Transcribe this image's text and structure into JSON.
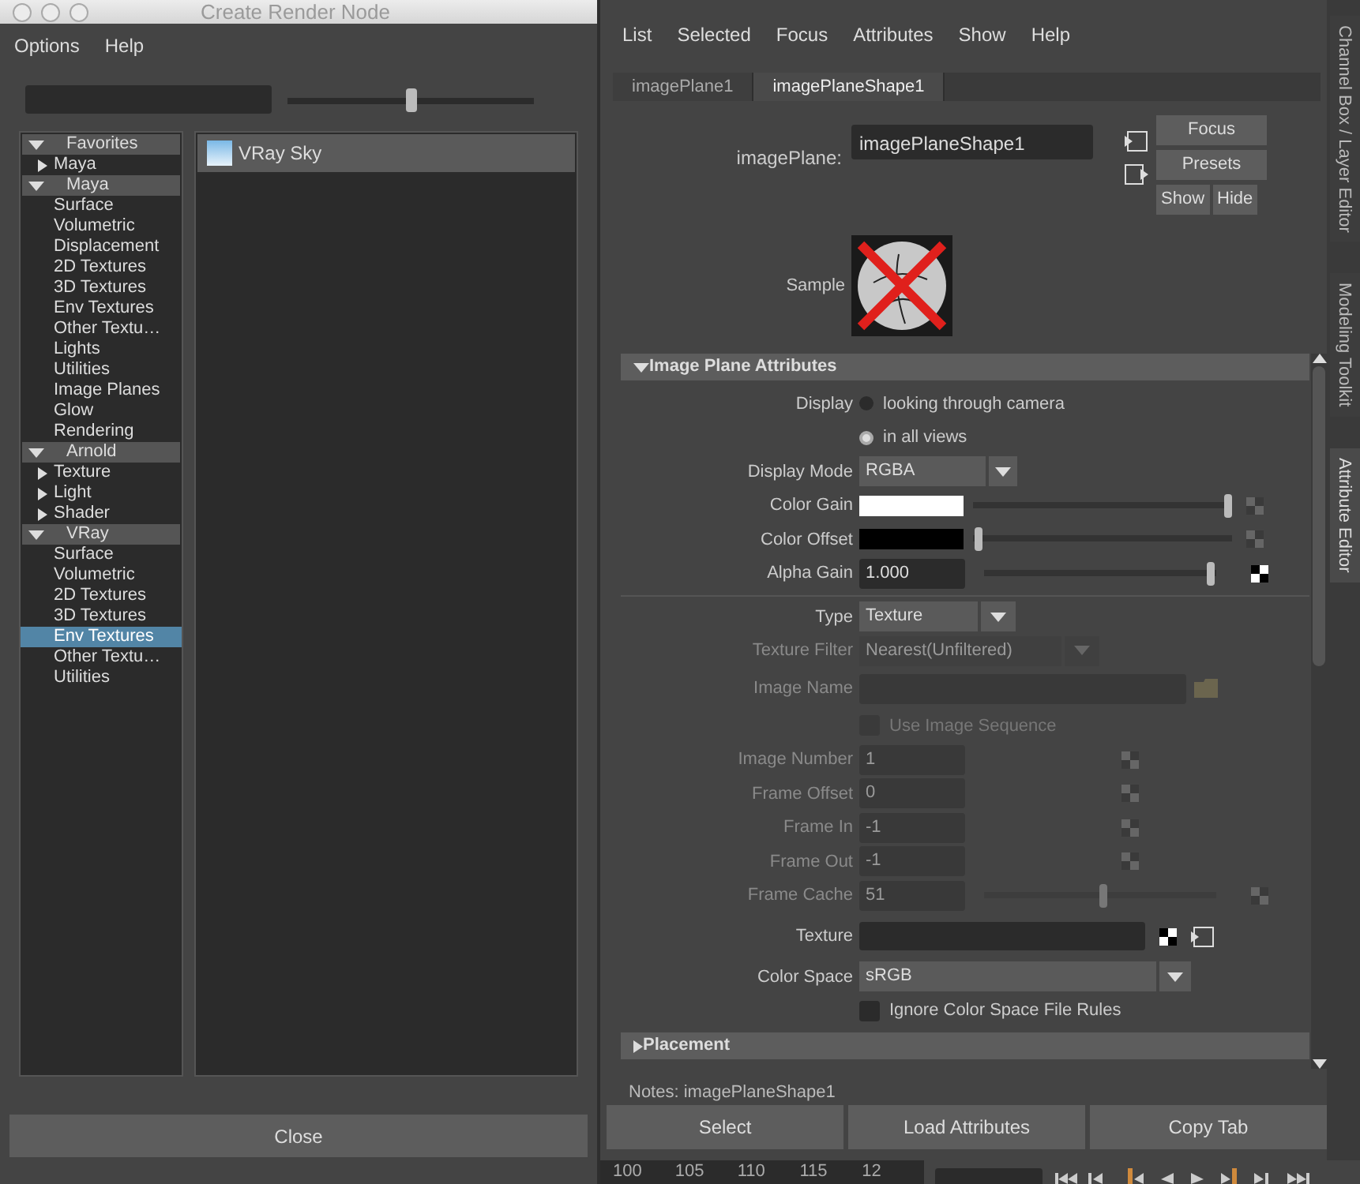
{
  "render_node_window": {
    "title": "Create Render Node",
    "menu": [
      "Options",
      "Help"
    ],
    "size_slider": {
      "level": 0.5
    },
    "tree": [
      {
        "label": "Favorites",
        "kind": "category",
        "expanded": true,
        "selected": false,
        "children": [
          {
            "label": "Maya",
            "kind": "group",
            "expanded": false,
            "selected": false
          }
        ]
      },
      {
        "label": "Maya",
        "kind": "category",
        "expanded": true,
        "selected": false,
        "children": [
          {
            "label": "Surface",
            "kind": "item",
            "selected": false
          },
          {
            "label": "Volumetric",
            "kind": "item",
            "selected": false
          },
          {
            "label": "Displacement",
            "kind": "item",
            "selected": false
          },
          {
            "label": "2D Textures",
            "kind": "item",
            "selected": false
          },
          {
            "label": "3D Textures",
            "kind": "item",
            "selected": false
          },
          {
            "label": "Env Textures",
            "kind": "item",
            "selected": false
          },
          {
            "label": "Other Textu…",
            "kind": "item",
            "selected": false
          },
          {
            "label": "Lights",
            "kind": "item",
            "selected": false
          },
          {
            "label": "Utilities",
            "kind": "item",
            "selected": false
          },
          {
            "label": "Image Planes",
            "kind": "item",
            "selected": false
          },
          {
            "label": "Glow",
            "kind": "item",
            "selected": false
          },
          {
            "label": "Rendering",
            "kind": "item",
            "selected": false
          }
        ]
      },
      {
        "label": "Arnold",
        "kind": "category",
        "expanded": true,
        "selected": false,
        "children": [
          {
            "label": "Texture",
            "kind": "group",
            "expanded": false,
            "selected": false
          },
          {
            "label": "Light",
            "kind": "group",
            "expanded": false,
            "selected": false
          },
          {
            "label": "Shader",
            "kind": "group",
            "expanded": false,
            "selected": false
          }
        ]
      },
      {
        "label": "VRay",
        "kind": "category",
        "expanded": true,
        "selected": false,
        "children": [
          {
            "label": "Surface",
            "kind": "item",
            "selected": false
          },
          {
            "label": "Volumetric",
            "kind": "item",
            "selected": false
          },
          {
            "label": "2D Textures",
            "kind": "item",
            "selected": false
          },
          {
            "label": "3D Textures",
            "kind": "item",
            "selected": false
          },
          {
            "label": "Env Textures",
            "kind": "item",
            "selected": true
          },
          {
            "label": "Other Textu…",
            "kind": "item",
            "selected": false
          },
          {
            "label": "Utilities",
            "kind": "item",
            "selected": false
          }
        ]
      }
    ],
    "nodes": [
      {
        "label": "VRay Sky",
        "selected": true
      }
    ],
    "close_button": "Close"
  },
  "attribute_editor": {
    "menu": [
      "List",
      "Selected",
      "Focus",
      "Attributes",
      "Show",
      "Help"
    ],
    "tabs": [
      {
        "label": "imagePlane1",
        "selected": false
      },
      {
        "label": "imagePlaneShape1",
        "selected": true
      }
    ],
    "node_field": {
      "label": "imagePlane:",
      "value": "imagePlaneShape1"
    },
    "buttons": [
      "Focus",
      "Presets",
      "Show",
      "Hide"
    ],
    "sample_label": "Sample",
    "sections": [
      {
        "title": "Image Plane Attributes",
        "expanded": true,
        "rows": [
          {
            "kind": "radio",
            "label": "Display",
            "options": [
              {
                "label": "looking through camera",
                "selected": false
              },
              {
                "label": "in all views",
                "selected": true
              }
            ]
          },
          {
            "kind": "dropdown",
            "label": "Display Mode",
            "value": "RGBA",
            "disabled": false
          },
          {
            "kind": "color",
            "label": "Color Gain",
            "color": "#ffffff",
            "level": 0.98
          },
          {
            "kind": "color",
            "label": "Color Offset",
            "color": "#000000",
            "level": 0.02
          },
          {
            "kind": "number",
            "label": "Alpha Gain",
            "value": "1.000",
            "level": 0.97,
            "disabled": false,
            "mappable": true
          },
          {
            "kind": "separator"
          },
          {
            "kind": "dropdown",
            "label": "Type",
            "value": "Texture",
            "disabled": false
          },
          {
            "kind": "dropdown",
            "label": "Texture Filter",
            "value": "Nearest(Unfiltered)",
            "disabled": true
          },
          {
            "kind": "file",
            "label": "Image Name",
            "disabled": true
          },
          {
            "kind": "checkbox",
            "label": "Use Image Sequence",
            "checked": false,
            "disabled": true
          },
          {
            "kind": "number",
            "label": "Image Number",
            "value": "1",
            "disabled": true,
            "mappable": true
          },
          {
            "kind": "number",
            "label": "Frame Offset",
            "value": "0",
            "disabled": true,
            "mappable": true
          },
          {
            "kind": "number",
            "label": "Frame In",
            "value": "-1",
            "disabled": true,
            "mappable": true
          },
          {
            "kind": "number",
            "label": "Frame Out",
            "value": "-1",
            "disabled": true,
            "mappable": true
          },
          {
            "kind": "number",
            "label": "Frame Cache",
            "value": "51",
            "level": 0.51,
            "disabled": true,
            "mappable": true
          },
          {
            "kind": "texture",
            "label": "Texture",
            "disabled": false
          },
          {
            "kind": "dropdown",
            "label": "Color Space",
            "value": "sRGB",
            "disabled": false
          },
          {
            "kind": "checkbox",
            "label": "Ignore Color Space File Rules",
            "checked": false,
            "disabled": false
          }
        ]
      },
      {
        "title": "Placement",
        "expanded": false
      }
    ],
    "notes": "Notes:  imagePlaneShape1",
    "bottom_buttons": [
      "Select",
      "Load Attributes",
      "Copy Tab"
    ]
  },
  "side_tabs": [
    {
      "label": "Channel Box / Layer Editor",
      "selected": false
    },
    {
      "label": "Modeling Toolkit",
      "selected": false
    },
    {
      "label": "Attribute Editor",
      "selected": true
    }
  ],
  "timeline": {
    "ticks": [
      "100",
      "105",
      "110",
      "115",
      "12"
    ]
  }
}
